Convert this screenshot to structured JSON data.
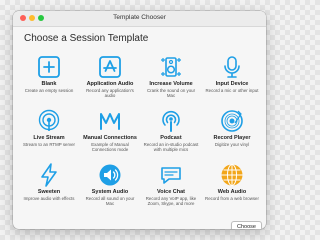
{
  "window": {
    "title": "Template Chooser"
  },
  "heading": "Choose a Session Template",
  "templates": [
    {
      "name": "Blank",
      "desc": [
        "Create an empty session"
      ],
      "icon": "plus-square-icon"
    },
    {
      "name": "Application Audio",
      "desc": [
        "Record any application's",
        "audio"
      ],
      "icon": "app-store-icon"
    },
    {
      "name": "Increase Volume",
      "desc": [
        "Crank the sound on your",
        "Mac"
      ],
      "icon": "speaker-icon"
    },
    {
      "name": "Input Device",
      "desc": [
        "Record a mic or other input"
      ],
      "icon": "microphone-icon"
    },
    {
      "name": "Live Stream",
      "desc": [
        "Stream to an RTMP server"
      ],
      "icon": "antenna-icon"
    },
    {
      "name": "Manual Connections",
      "desc": [
        "Example of Manual",
        "Connections mode"
      ],
      "icon": "manual-connections-icon"
    },
    {
      "name": "Podcast",
      "desc": [
        "Record an in-studio podcast",
        "with multiple mics"
      ],
      "icon": "podcast-icon"
    },
    {
      "name": "Record Player",
      "desc": [
        "Digitize your vinyl"
      ],
      "icon": "vinyl-record-icon"
    },
    {
      "name": "Sweeten",
      "desc": [
        "Improve audio with effects"
      ],
      "icon": "lightning-icon"
    },
    {
      "name": "System Audio",
      "desc": [
        "Record all sound on your",
        "Mac"
      ],
      "icon": "system-audio-icon"
    },
    {
      "name": "Voice Chat",
      "desc": [
        "Record any VoIP app, like",
        "Zoom, Skype, and more"
      ],
      "icon": "chat-bubble-icon"
    },
    {
      "name": "Web Audio",
      "desc": [
        "Record from a web browser"
      ],
      "icon": "globe-icon"
    }
  ],
  "footer": {
    "choose_label": "Choose"
  },
  "colors": {
    "icon_blue": "#1e9fe6",
    "globe_orange": "#f2a619"
  }
}
